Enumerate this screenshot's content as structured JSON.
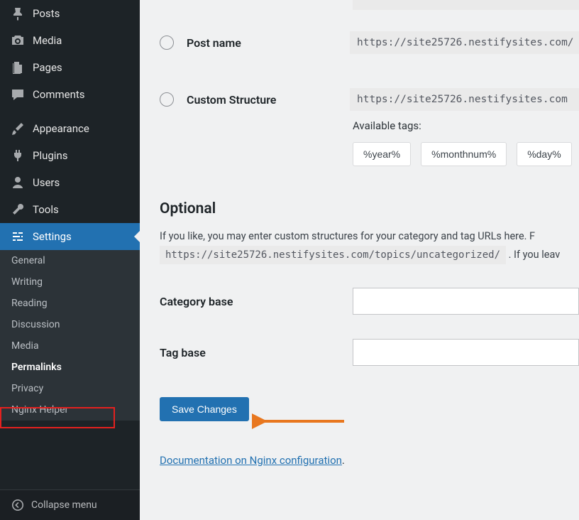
{
  "sidebar": {
    "main_items": [
      {
        "icon": "pin-icon",
        "label": "Posts"
      },
      {
        "icon": "camera-icon",
        "label": "Media"
      },
      {
        "icon": "page-icon",
        "label": "Pages"
      },
      {
        "icon": "comment-icon",
        "label": "Comments"
      }
    ],
    "admin_items": [
      {
        "icon": "brush-icon",
        "label": "Appearance"
      },
      {
        "icon": "plug-icon",
        "label": "Plugins"
      },
      {
        "icon": "user-icon",
        "label": "Users"
      },
      {
        "icon": "wrench-icon",
        "label": "Tools"
      },
      {
        "icon": "sliders-icon",
        "label": "Settings",
        "active": true
      }
    ],
    "sub_items": [
      {
        "label": "General"
      },
      {
        "label": "Writing"
      },
      {
        "label": "Reading"
      },
      {
        "label": "Discussion"
      },
      {
        "label": "Media"
      },
      {
        "label": "Permalinks",
        "current": true
      },
      {
        "label": "Privacy"
      },
      {
        "label": "Nginx Helper"
      }
    ],
    "collapse_label": "Collapse menu"
  },
  "main": {
    "post_name_label": "Post name",
    "post_name_url": "https://site25726.nestifysites.com/",
    "custom_label": "Custom Structure",
    "custom_url": "https://site25726.nestifysites.com",
    "available_tags_label": "Available tags:",
    "tags": [
      "%year%",
      "%monthnum%",
      "%day%"
    ],
    "optional_heading": "Optional",
    "optional_text_1": "If you like, you may enter custom structures for your category and tag URLs here. F",
    "example_url": "https://site25726.nestifysites.com/topics/uncategorized/",
    "optional_text_2": " . If you leav",
    "category_base_label": "Category base",
    "tag_base_label": "Tag base",
    "save_label": "Save Changes",
    "doc_link_text": "Documentation on Nginx configuration",
    "doc_link_suffix": "."
  }
}
